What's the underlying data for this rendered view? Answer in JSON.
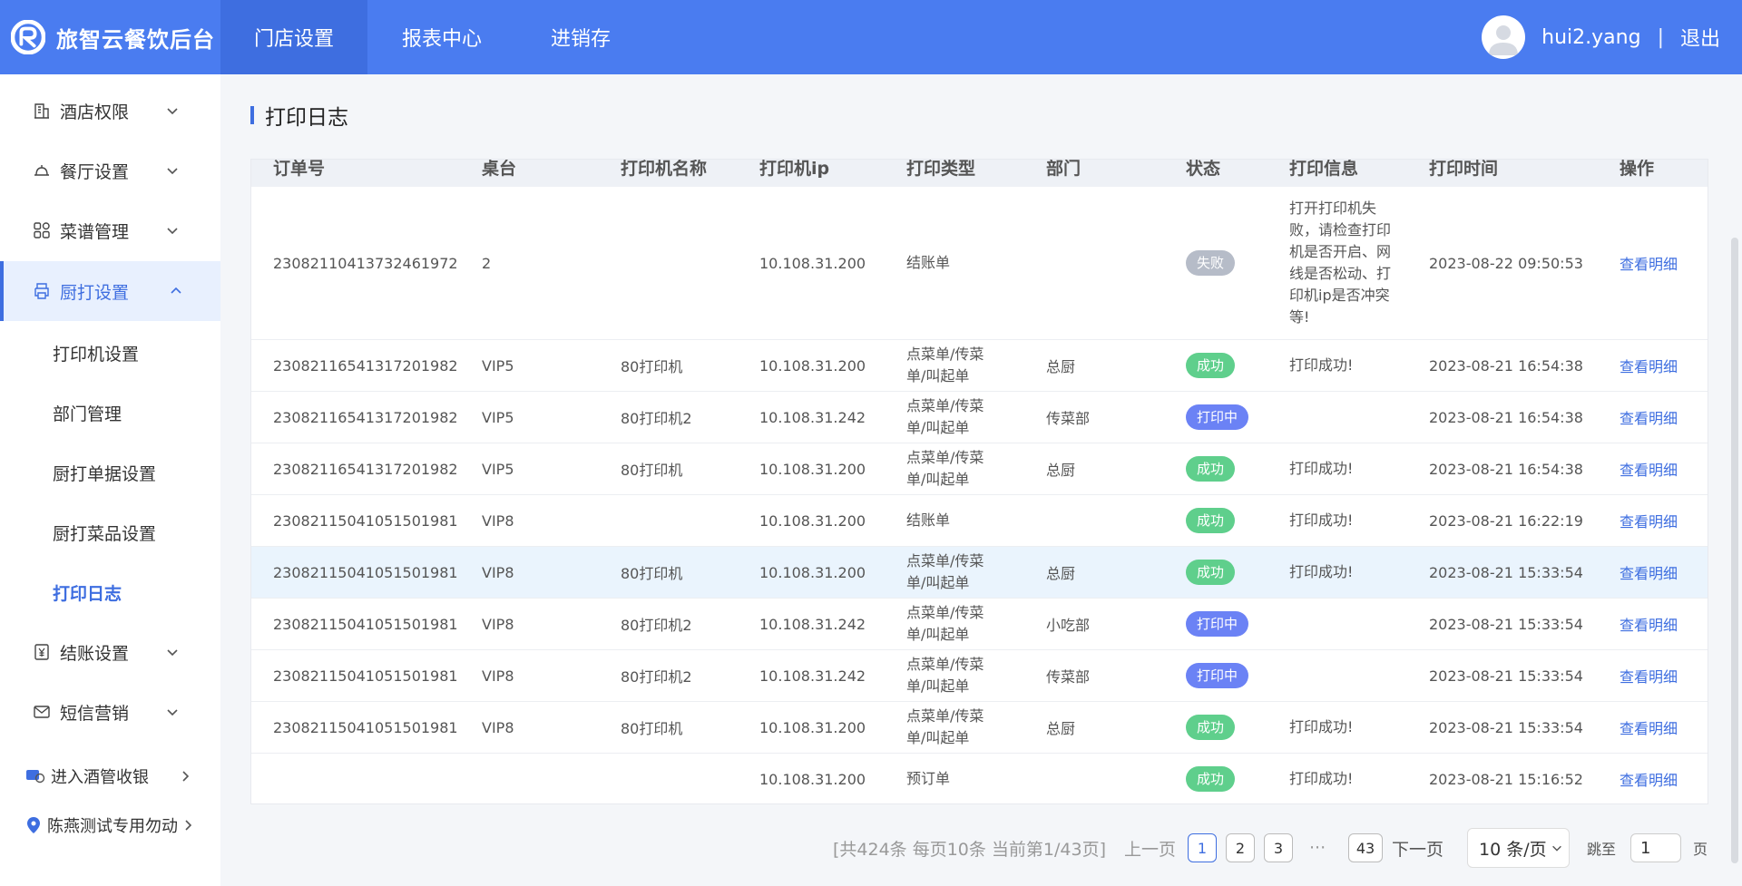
{
  "header": {
    "brand": "旅智云餐饮后台",
    "nav": [
      "门店设置",
      "报表中心",
      "进销存"
    ],
    "username": "hui2.yang",
    "separator": "|",
    "logout": "退出"
  },
  "sidebar": {
    "items": [
      {
        "label": "酒店权限"
      },
      {
        "label": "餐厅设置"
      },
      {
        "label": "菜谱管理"
      },
      {
        "label": "厨打设置"
      },
      {
        "label": "结账设置"
      },
      {
        "label": "短信营销"
      }
    ],
    "sub_items": [
      "打印机设置",
      "部门管理",
      "厨打单据设置",
      "厨打菜品设置",
      "打印日志"
    ],
    "overlap_label": "进入酒管收银",
    "location_label": "陈燕测试专用勿动"
  },
  "page": {
    "title": "打印日志"
  },
  "table": {
    "headers": [
      "订单号",
      "桌台",
      "打印机名称",
      "打印机ip",
      "打印类型",
      "部门",
      "状态",
      "打印信息",
      "打印时间",
      "操作"
    ],
    "rows": [
      {
        "order": "23082110413732461972",
        "table": "2",
        "printer": "",
        "ip": "10.108.31.200",
        "type": "结账单",
        "dept": "",
        "status": "失败",
        "info": "打开打印机失败，请检查打印机是否开启、网线是否松动、打印机ip是否冲突等!",
        "time": "2023-08-22 09:50:53",
        "action": "查看明细"
      },
      {
        "order": "23082116541317201982",
        "table": "VIP5",
        "printer": "80打印机",
        "ip": "10.108.31.200",
        "type": "点菜单/传菜单/叫起单",
        "dept": "总厨",
        "status": "成功",
        "info": "打印成功!",
        "time": "2023-08-21 16:54:38",
        "action": "查看明细"
      },
      {
        "order": "23082116541317201982",
        "table": "VIP5",
        "printer": "80打印机2",
        "ip": "10.108.31.242",
        "type": "点菜单/传菜单/叫起单",
        "dept": "传菜部",
        "status": "打印中",
        "info": "",
        "time": "2023-08-21 16:54:38",
        "action": "查看明细"
      },
      {
        "order": "23082116541317201982",
        "table": "VIP5",
        "printer": "80打印机",
        "ip": "10.108.31.200",
        "type": "点菜单/传菜单/叫起单",
        "dept": "总厨",
        "status": "成功",
        "info": "打印成功!",
        "time": "2023-08-21 16:54:38",
        "action": "查看明细"
      },
      {
        "order": "23082115041051501981",
        "table": "VIP8",
        "printer": "",
        "ip": "10.108.31.200",
        "type": "结账单",
        "dept": "",
        "status": "成功",
        "info": "打印成功!",
        "time": "2023-08-21 16:22:19",
        "action": "查看明细"
      },
      {
        "order": "23082115041051501981",
        "table": "VIP8",
        "printer": "80打印机",
        "ip": "10.108.31.200",
        "type": "点菜单/传菜单/叫起单",
        "dept": "总厨",
        "status": "成功",
        "info": "打印成功!",
        "time": "2023-08-21 15:33:54",
        "action": "查看明细"
      },
      {
        "order": "23082115041051501981",
        "table": "VIP8",
        "printer": "80打印机2",
        "ip": "10.108.31.242",
        "type": "点菜单/传菜单/叫起单",
        "dept": "小吃部",
        "status": "打印中",
        "info": "",
        "time": "2023-08-21 15:33:54",
        "action": "查看明细"
      },
      {
        "order": "23082115041051501981",
        "table": "VIP8",
        "printer": "80打印机2",
        "ip": "10.108.31.242",
        "type": "点菜单/传菜单/叫起单",
        "dept": "传菜部",
        "status": "打印中",
        "info": "",
        "time": "2023-08-21 15:33:54",
        "action": "查看明细"
      },
      {
        "order": "23082115041051501981",
        "table": "VIP8",
        "printer": "80打印机",
        "ip": "10.108.31.200",
        "type": "点菜单/传菜单/叫起单",
        "dept": "总厨",
        "status": "成功",
        "info": "打印成功!",
        "time": "2023-08-21 15:33:54",
        "action": "查看明细"
      },
      {
        "order": "",
        "table": "",
        "printer": "",
        "ip": "10.108.31.200",
        "type": "预订单",
        "dept": "",
        "status": "成功",
        "info": "打印成功!",
        "time": "2023-08-21 15:16:52",
        "action": "查看明细"
      }
    ],
    "status_colors": {
      "成功": "#5fcf8c",
      "打印中": "#6b82f5",
      "失败": "#b6bcc8"
    }
  },
  "pagination": {
    "summary": "[共424条 每页10条 当前第1/43页]",
    "prev": "上一页",
    "pages": [
      "1",
      "2",
      "3"
    ],
    "ellipsis": "···",
    "last": "43",
    "next": "下一页",
    "page_size": "10 条/页",
    "jump_label": "跳至",
    "jump_value": "1",
    "page_suffix": "页"
  }
}
